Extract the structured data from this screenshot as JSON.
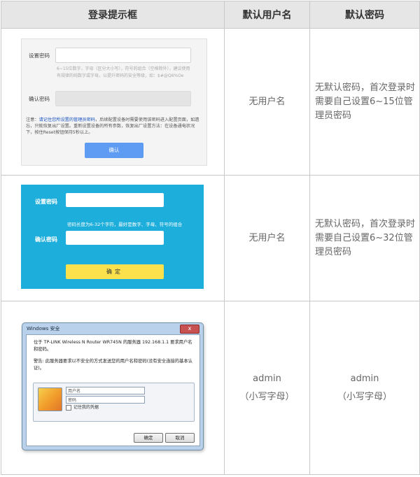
{
  "header": {
    "col1": "登录提示框",
    "col2": "默认用户名",
    "col3": "默认密码"
  },
  "rows": [
    {
      "username": "无用户名",
      "password": "无默认密码，首次登录时需要自己设置6~15位管理员密码",
      "box": {
        "set_label": "设置密码",
        "hint": "6~15位数字，字母（区分大小写），符号的组合（空格除外），建议使用有规律的纯数字或字母，以提升密码的安全等级，如：$#@Q6%Oe",
        "confirm_label": "确认密码",
        "note_prefix": "注意：",
        "note_link": "请记住您所设置的管理员密码",
        "note_rest": "，后续配置设备时需要使用该密码进入配置页面，如遗忘，只能恢复出厂设置。重新设置设备的所有参数，恢复出厂设置方法：在设备通电状况下，按住Reset按钮保持5秒以上。",
        "button": "确认"
      }
    },
    {
      "username": "无用户名",
      "password": "无默认密码，首次登录时需要自己设置6~32位管理员密码",
      "box": {
        "set_label": "设置密码",
        "hint": "密码长度为6-32个字符，最好是数字、字母、符号的组合",
        "confirm_label": "确认密码",
        "button": "确定"
      }
    },
    {
      "username": "admin",
      "username_note": "（小写字母）",
      "password": "admin",
      "password_note": "（小写字母）",
      "dialog": {
        "title": "Windows 安全",
        "close": "x",
        "message": "位于 TP-LINK Wireless N Router WR745N 的服务器 192.168.1.1 要求用户名和密码。",
        "warning": "警告: 此服务器要求以不安全的方式发送您的用户名和密码(没有安全连接的基本认证)。",
        "user_placeholder": "用户名",
        "pass_placeholder": "密码",
        "remember": "记住我的凭据",
        "ok": "确定",
        "cancel": "取消"
      }
    }
  ]
}
